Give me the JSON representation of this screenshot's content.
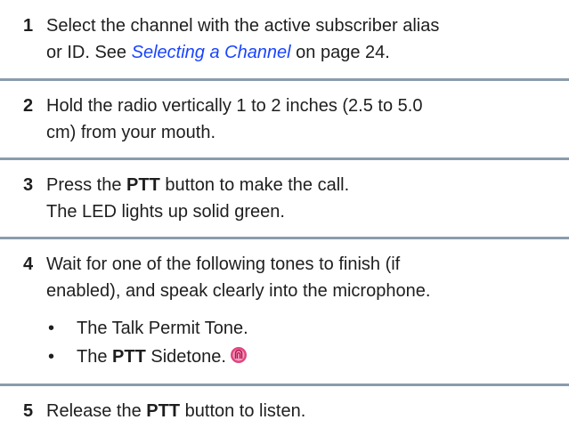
{
  "steps": [
    {
      "number": "1",
      "lines": [
        "Select the channel with the active subscriber alias",
        "or ID. See "
      ],
      "link": "Selecting a Channel",
      "after_link": " on page 24."
    },
    {
      "number": "2",
      "lines": [
        "Hold the radio vertically 1 to 2 inches (2.5 to 5.0",
        "cm) from your mouth."
      ]
    },
    {
      "number": "3",
      "pre": "Press the ",
      "bold": "PTT",
      "post": " button to make the call.",
      "line2": "The LED lights up solid green."
    },
    {
      "number": "4",
      "lines": [
        "Wait for one of the following tones to finish (if",
        "enabled), and speak clearly into the microphone."
      ],
      "bullets": {
        "b1": "The Talk Permit Tone.",
        "b2_pre": "The ",
        "b2_bold": "PTT",
        "b2_post": " Sidetone."
      }
    },
    {
      "number": "5",
      "pre": "Release the ",
      "bold": "PTT",
      "post": " button to listen."
    }
  ],
  "bullet_glyph": "•",
  "colors": {
    "separator": "#8a9cad",
    "link": "#1a44ff",
    "icon": "#e0457f"
  },
  "icons": {
    "sidetone": "sidetone-icon"
  }
}
